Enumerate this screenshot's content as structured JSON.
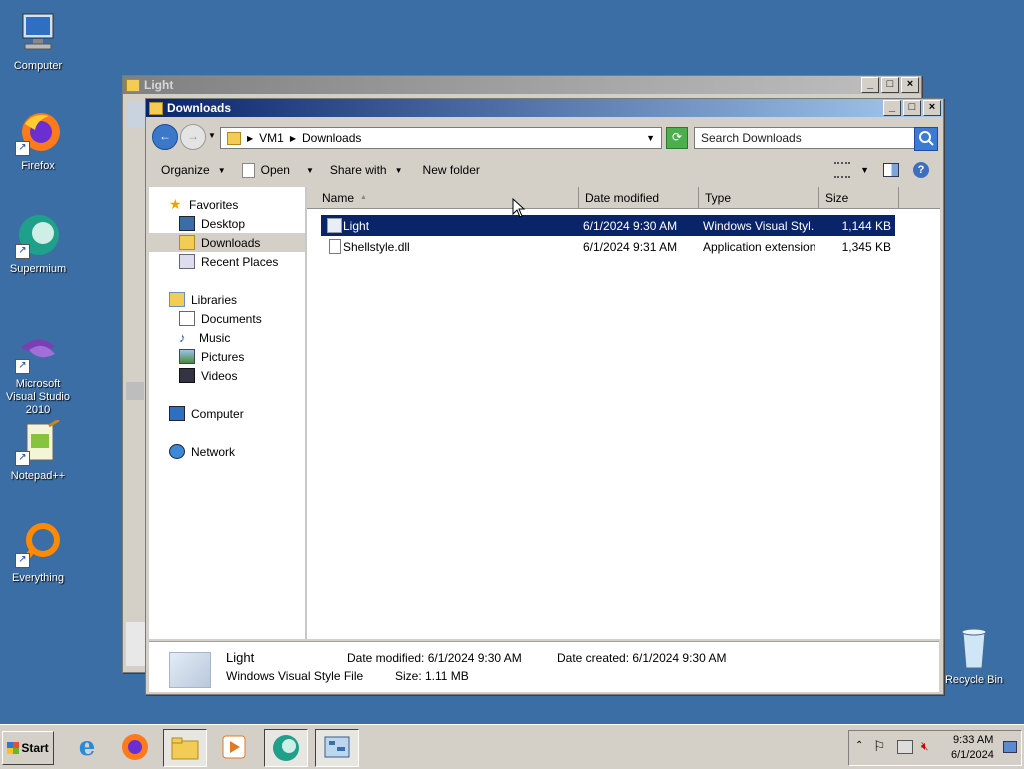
{
  "desktop": {
    "icons": [
      {
        "label": "Computer"
      },
      {
        "label": "Firefox"
      },
      {
        "label": "Supermium"
      },
      {
        "label": "Microsoft Visual Studio 2010"
      },
      {
        "label": "Notepad++"
      },
      {
        "label": "Everything"
      },
      {
        "label": "Recycle Bin"
      }
    ]
  },
  "back_window": {
    "title": "Light"
  },
  "window": {
    "title": "Downloads",
    "breadcrumb": [
      "VM1",
      "Downloads"
    ],
    "search_placeholder": "Search Downloads",
    "toolbar": {
      "organize": "Organize",
      "open": "Open",
      "share_with": "Share with",
      "new_folder": "New folder"
    },
    "nav": {
      "favorites": "Favorites",
      "desktop": "Desktop",
      "downloads": "Downloads",
      "recent_places": "Recent Places",
      "libraries": "Libraries",
      "documents": "Documents",
      "music": "Music",
      "pictures": "Pictures",
      "videos": "Videos",
      "computer": "Computer",
      "network": "Network"
    },
    "columns": {
      "name": "Name",
      "date_modified": "Date modified",
      "type": "Type",
      "size": "Size"
    },
    "files": [
      {
        "name": "Light",
        "date": "6/1/2024 9:30 AM",
        "type": "Windows Visual Styl...",
        "size": "1,144 KB"
      },
      {
        "name": "Shellstyle.dll",
        "date": "6/1/2024 9:31 AM",
        "type": "Application extension",
        "size": "1,345 KB"
      }
    ],
    "details": {
      "name": "Light",
      "type": "Windows Visual Style File",
      "date_modified_label": "Date modified: 6/1/2024 9:30 AM",
      "size_label": "Size: 1.11 MB",
      "date_created_label": "Date created: 6/1/2024 9:30 AM"
    }
  },
  "taskbar": {
    "start": "Start",
    "time": "9:33 AM",
    "date": "6/1/2024"
  },
  "colors": {
    "desktop": "#3a6ea5",
    "selection": "#0a246a",
    "titlebar_active": "#0a246a"
  }
}
